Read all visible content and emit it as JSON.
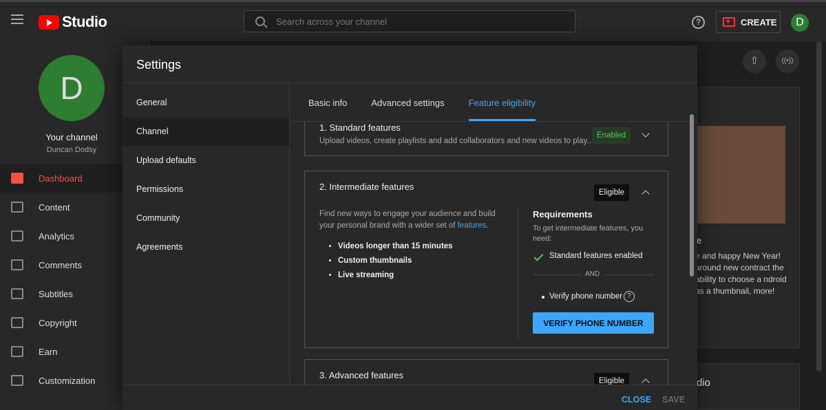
{
  "topbar": {
    "logo_text": "Studio",
    "search_placeholder": "Search across your channel",
    "help_symbol": "?",
    "create_label": "CREATE",
    "avatar_letter": "D",
    "icons": [
      "menu-icon",
      "youtube-logo-icon",
      "search-icon",
      "help-icon",
      "create-video-icon"
    ]
  },
  "sidebar": {
    "avatar_letter": "D",
    "channel_title": "Your channel",
    "channel_name": "Duncan Dodsy",
    "items": [
      {
        "label": "Dashboard",
        "active": true,
        "icon": "dashboard-icon"
      },
      {
        "label": "Content",
        "icon": "content-icon"
      },
      {
        "label": "Analytics",
        "icon": "analytics-icon"
      },
      {
        "label": "Comments",
        "icon": "comments-icon"
      },
      {
        "label": "Subtitles",
        "icon": "subtitles-icon"
      },
      {
        "label": "Copyright",
        "icon": "copyright-icon"
      },
      {
        "label": "Earn",
        "icon": "earn-icon"
      },
      {
        "label": "Customization",
        "icon": "customization-icon"
      }
    ]
  },
  "background": {
    "thumb_text": "e and happy New Year! around new contract the ability to choose a ndroid as a thumbnail, more!",
    "title_fragment": "e",
    "card2_text": "dio",
    "upload_symbol": "⇧",
    "live_symbol": "((•))"
  },
  "modal": {
    "title": "Settings",
    "nav": [
      {
        "label": "General"
      },
      {
        "label": "Channel",
        "active": true
      },
      {
        "label": "Upload defaults"
      },
      {
        "label": "Permissions"
      },
      {
        "label": "Community"
      },
      {
        "label": "Agreements"
      }
    ],
    "tabs": [
      {
        "label": "Basic info"
      },
      {
        "label": "Advanced settings"
      },
      {
        "label": "Feature eligibility",
        "active": true
      }
    ],
    "close_label": "CLOSE",
    "save_label": "SAVE",
    "standard": {
      "title": "1. Standard features",
      "subtitle": "Upload videos, create playlists and add collaborators and new videos to play...",
      "badge": "Enabled"
    },
    "intermediate": {
      "title": "2. Intermediate features",
      "badge": "Eligible",
      "desc_prefix": "Find new ways to engage your audience and build your personal brand with a wider set of ",
      "desc_link": "features",
      "desc_suffix": ".",
      "bullets": [
        "Videos longer than 15 minutes",
        "Custom thumbnails",
        "Live streaming"
      ],
      "req_title": "Requirements",
      "req_sub": "To get intermediate features, you need:",
      "req_met": "Standard features enabled",
      "and_text": "AND",
      "req_pending": "Verify phone number",
      "help_symbol": "?",
      "verify_button": "VERIFY PHONE NUMBER"
    },
    "advanced": {
      "title": "3. Advanced features",
      "badge": "Eligible"
    }
  },
  "colors": {
    "accent_blue": "#3ea6ff",
    "active_red": "#ff4e45",
    "enabled_green": "#5cc15c",
    "avatar_green": "#2e7d32"
  }
}
